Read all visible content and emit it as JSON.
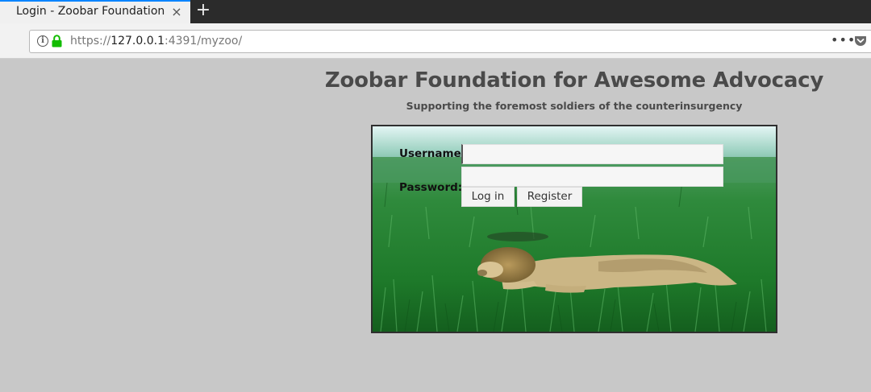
{
  "browser": {
    "tab_title": "Login - Zoobar Foundation",
    "tab_close": "×",
    "new_tab": "+",
    "url_scheme": "https://",
    "url_host": "127.0.0.1",
    "url_rest": ":4391/myzoo/",
    "more_glyph": "•••",
    "info_glyph": "i",
    "icons": [
      "info-icon",
      "lock-icon",
      "more-icon",
      "pocket-icon",
      "close-icon",
      "plus-icon"
    ],
    "colors": {
      "tab_accent": "#0a84ff",
      "lock": "#12bc00",
      "pocket": "#6b6b6b"
    }
  },
  "page": {
    "title": "Zoobar Foundation for Awesome Advocacy",
    "subtitle": "Supporting the foremost soldiers of the counterinsurgency",
    "background": "#c8c8c8"
  },
  "login": {
    "username_label": "Username:",
    "password_label": "Password:",
    "username_value": "",
    "password_value": "",
    "login_button": "Log in",
    "register_button": "Register"
  }
}
